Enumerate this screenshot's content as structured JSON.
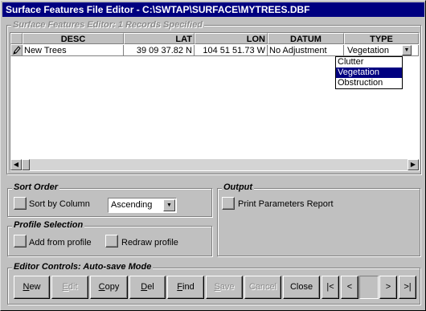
{
  "window": {
    "title": "Surface Features File Editor - C:\\SWTAP\\SURFACE\\MYTREES.DBF"
  },
  "records_panel": {
    "legend": "Surface Features Editor: 1 Records Specified",
    "columns": [
      "DESC",
      "LAT",
      "LON",
      "DATUM",
      "TYPE"
    ],
    "rows": [
      {
        "row_marker_icon": "pencil-icon",
        "desc": "New Trees",
        "lat": "39 09 37.82 N",
        "lon": "104 51 51.73 W",
        "datum": "No Adjustment",
        "type": "Vegetation"
      }
    ],
    "type_dropdown": {
      "options": [
        "Clutter",
        "Vegetation",
        "Obstruction"
      ],
      "selected": "Vegetation"
    }
  },
  "sort_order": {
    "legend": "Sort Order",
    "sort_by_column_label": "Sort by Column",
    "direction_value": "Ascending"
  },
  "output": {
    "legend": "Output",
    "print_report_label": "Print Parameters Report"
  },
  "profile_selection": {
    "legend": "Profile Selection",
    "add_from_profile_label": "Add from profile",
    "redraw_profile_label": "Redraw profile"
  },
  "editor_controls": {
    "legend": "Editor Controls: Auto-save Mode",
    "buttons": [
      {
        "hot": "N",
        "rest": "ew",
        "enabled": true
      },
      {
        "hot": "E",
        "rest": "dit",
        "enabled": false
      },
      {
        "hot": "C",
        "rest": "opy",
        "enabled": true
      },
      {
        "hot": "D",
        "rest": "el",
        "enabled": true
      },
      {
        "hot": "F",
        "rest": "ind",
        "enabled": true
      },
      {
        "hot": "S",
        "rest": "ave",
        "enabled": false
      },
      {
        "hot": "",
        "rest": "Cancel",
        "enabled": false
      },
      {
        "hot": "",
        "rest": "Close",
        "enabled": true
      }
    ],
    "nav": [
      "|<",
      "<",
      ">",
      ">|"
    ]
  }
}
